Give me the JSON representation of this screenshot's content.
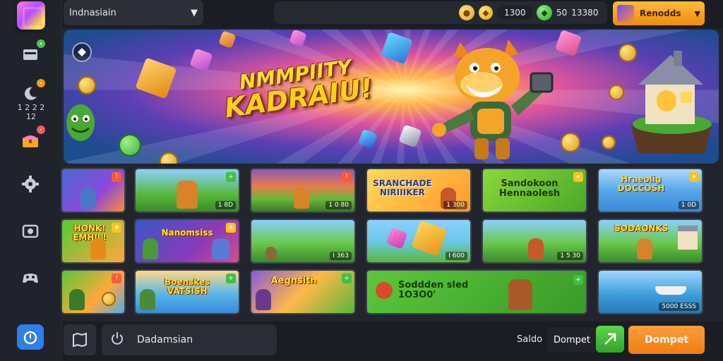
{
  "topbar": {
    "region_label": "Indnasiain",
    "stat_gold": "1300",
    "stat_green": "50",
    "stat_green_total": "13380",
    "rewards_label": "Renodds"
  },
  "sidebar": {
    "label": "1 2 2 2 12"
  },
  "banner": {
    "title_line1": "NMMPIITY",
    "title_line2": "KADRAIU!"
  },
  "tiles": [
    {
      "title": "",
      "meta": "",
      "badge": ""
    },
    {
      "title": "",
      "meta": "1 8D",
      "badge": ""
    },
    {
      "title": "",
      "meta": "1 0 80",
      "badge": ""
    },
    {
      "title": "SRANCHADE NIRIIIKER",
      "meta": "1 300",
      "badge": ""
    },
    {
      "title": "Sandokoon Hennaolesh",
      "meta": "",
      "badge": ""
    },
    {
      "title": "Hraeolig DOCCOSH",
      "meta": "1 0D",
      "badge": ""
    },
    {
      "title": "HONK! EMHIL!",
      "meta": "",
      "badge": ""
    },
    {
      "title": "Nanomsiss",
      "meta": "",
      "badge": ""
    },
    {
      "title": "",
      "meta": "I 363",
      "badge": ""
    },
    {
      "title": "",
      "meta": "I 600",
      "badge": ""
    },
    {
      "title": "",
      "meta": "1 5 30",
      "badge": ""
    },
    {
      "title": "SODAONKS",
      "meta": "",
      "badge": ""
    },
    {
      "title": "",
      "meta": "",
      "badge": ""
    },
    {
      "title": "Boenskes VATSISH",
      "meta": "",
      "badge": ""
    },
    {
      "title": "Aegnsith",
      "meta": "",
      "badge": ""
    },
    {
      "title": "Soddden sled 1O3O0'",
      "meta": "",
      "badge": ""
    },
    {
      "title": "",
      "meta": "5000 ESSS",
      "badge": ""
    }
  ],
  "bottombar": {
    "search_text": "Dadamsian",
    "saldo_label": "Saldo",
    "dompet_label": "Dompet",
    "dompet_button": "Dompet"
  }
}
